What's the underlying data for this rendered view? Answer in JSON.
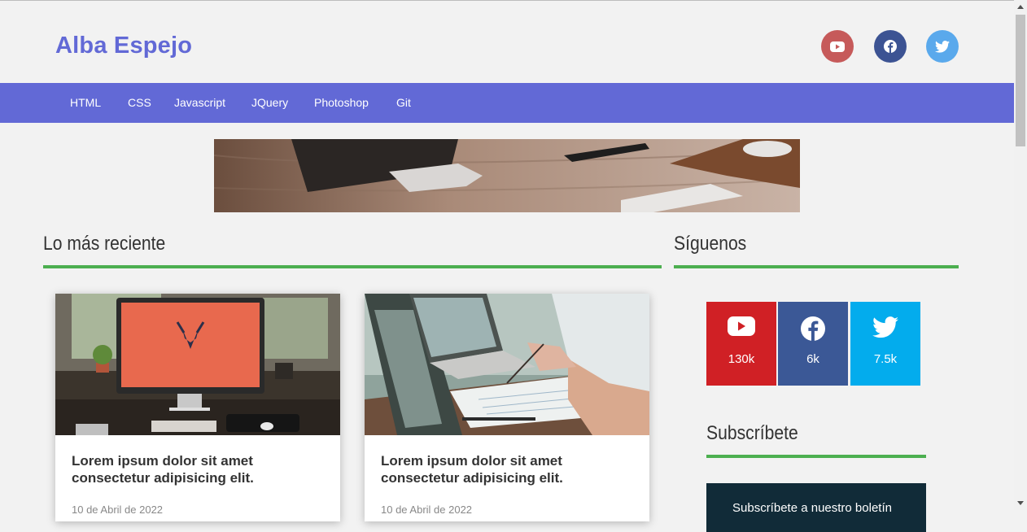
{
  "header": {
    "brand": "Alba Espejo"
  },
  "social_top": [
    {
      "icon": "youtube-icon",
      "color": "#c65a5a"
    },
    {
      "icon": "facebook-icon",
      "color": "#3c5393"
    },
    {
      "icon": "twitter-icon",
      "color": "#5aa9ec"
    }
  ],
  "nav": {
    "items": [
      "HTML",
      "CSS",
      "Javascript",
      "JQuery",
      "Photoshop",
      "Git"
    ]
  },
  "sections": {
    "recent": "Lo más reciente",
    "follow": "Síguenos",
    "subscribe": "Subscríbete"
  },
  "posts": [
    {
      "title": "Lorem ipsum dolor sit amet consectetur adipisicing elit.",
      "date": "10 de Abril de 2022"
    },
    {
      "title": "Lorem ipsum dolor sit amet consectetur adipisicing elit.",
      "date": "10 de Abril de 2022"
    }
  ],
  "follow": [
    {
      "network": "youtube",
      "count": "130k",
      "color": "#d02025"
    },
    {
      "network": "facebook",
      "count": "6k",
      "color": "#3b5896"
    },
    {
      "network": "twitter",
      "count": "7.5k",
      "color": "#03aced"
    }
  ],
  "subscribe_box": {
    "text": "Subscríbete a nuestro boletín"
  },
  "colors": {
    "brand": "#6269d6",
    "accent_bar": "#4caf50"
  }
}
